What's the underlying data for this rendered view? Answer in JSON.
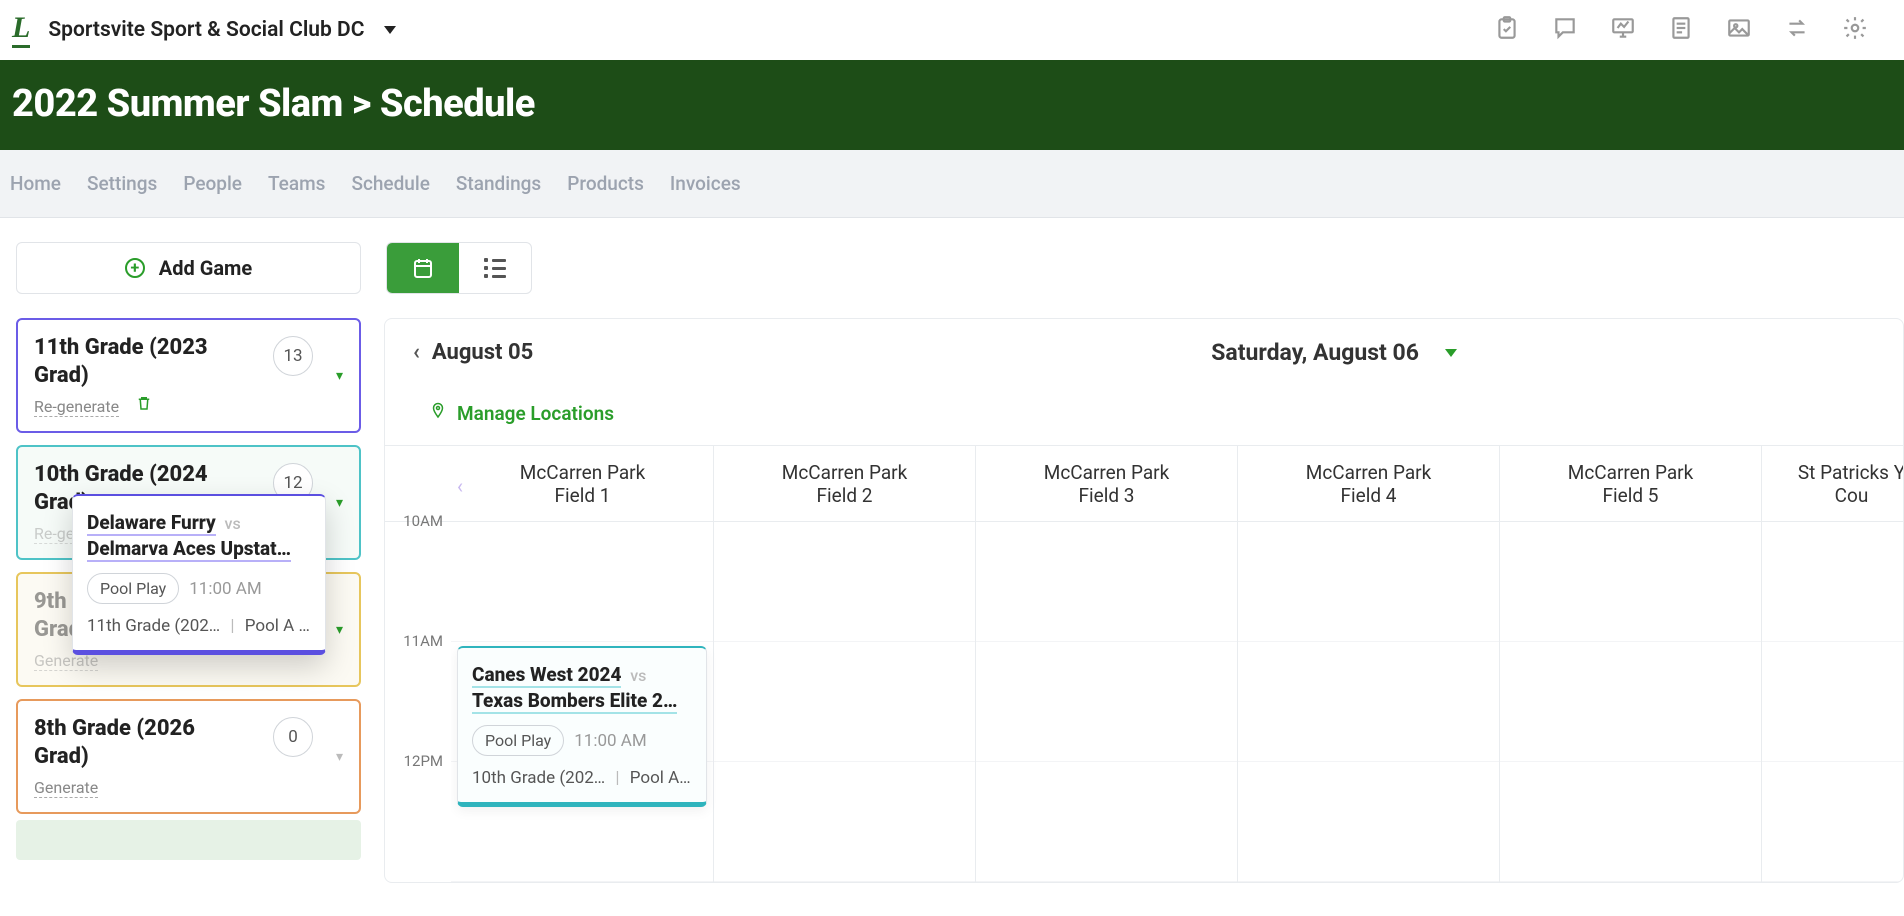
{
  "header": {
    "org_name": "Sportsvite Sport & Social Club DC"
  },
  "title_band": "2022 Summer Slam > Schedule",
  "subnav": [
    "Home",
    "Settings",
    "People",
    "Teams",
    "Schedule",
    "Standings",
    "Products",
    "Invoices"
  ],
  "buttons": {
    "add_game": "Add Game"
  },
  "grades": [
    {
      "title": "11th Grade (2023 Grad)",
      "count": "13",
      "action": "Re-generate"
    },
    {
      "title": "10th Grade (2024 Grad)",
      "count": "12",
      "action": "Re-generate"
    },
    {
      "title": "9th Grade (2025 Grad)",
      "count": "",
      "action": "Generate"
    },
    {
      "title": "8th Grade (2026 Grad)",
      "count": "0",
      "action": "Generate"
    }
  ],
  "drag_card": {
    "team_a": "Delaware Furry",
    "vs": "vs",
    "team_b": "Delmarva Aces Upstat…",
    "badge": "Pool Play",
    "time": "11:00 AM",
    "meta_grade": "11th Grade (202…",
    "meta_pool": "Pool A - …"
  },
  "calendar": {
    "prev_label": "August 05",
    "current_label": "Saturday, August 06",
    "manage_locations": "Manage Locations",
    "fields": [
      {
        "name": "McCarren Park",
        "sub": "Field 1"
      },
      {
        "name": "McCarren Park",
        "sub": "Field 2"
      },
      {
        "name": "McCarren Park",
        "sub": "Field 3"
      },
      {
        "name": "McCarren Park",
        "sub": "Field 4"
      },
      {
        "name": "McCarren Park",
        "sub": "Field 5"
      },
      {
        "name": "St Patricks Y",
        "sub": "Cou"
      }
    ],
    "times": [
      "10AM",
      "11AM",
      "12PM"
    ]
  },
  "cal_event": {
    "team_a": "Canes West 2024",
    "vs": "vs",
    "team_b": "Texas Bombers Elite 2…",
    "badge": "Pool Play",
    "time": "11:00 AM",
    "meta_grade": "10th Grade (202…",
    "meta_pool": "Pool A - …"
  }
}
